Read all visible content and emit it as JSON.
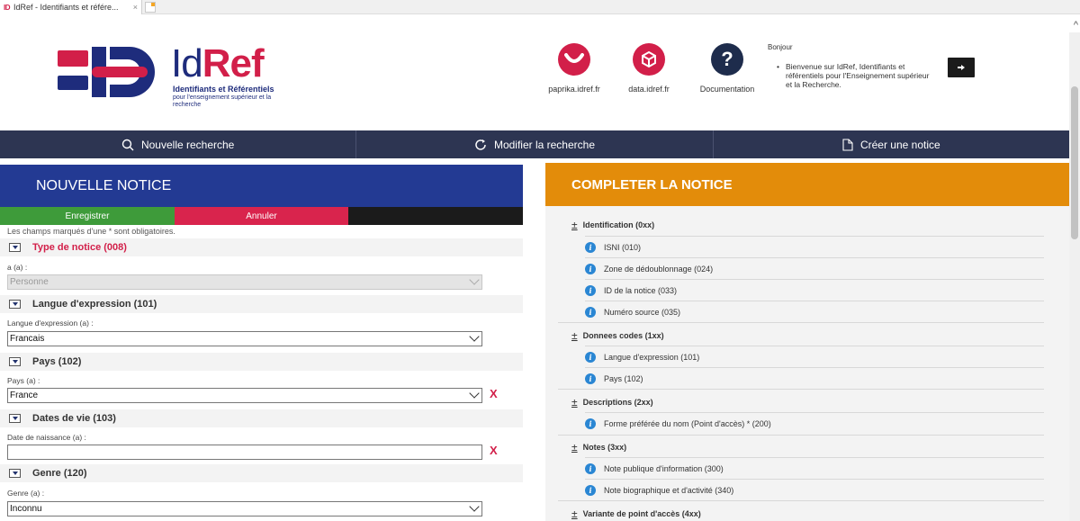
{
  "browser": {
    "tab_title": "IdRef - Identifiants et référe...",
    "tab_close": "×",
    "favicon": "ID"
  },
  "logo": {
    "word_id": "Id",
    "word_ref": "Ref",
    "sub1": "Identifiants et Référentiels",
    "sub2": "pour l'enseignement supérieur et la recherche"
  },
  "header_links": [
    {
      "label": "paprika.idref.fr",
      "icon": "smile-icon"
    },
    {
      "label": "data.idref.fr",
      "icon": "cube-icon"
    },
    {
      "label": "Documentation",
      "icon": "question-icon"
    }
  ],
  "greeting": {
    "title": "Bonjour",
    "text": "Bienvenue sur IdRef, Identifiants et référentiels pour l'Enseignement supérieur et la Recherche."
  },
  "logout_icon": "logout-icon",
  "nav": {
    "search": "Nouvelle recherche",
    "modify": "Modifier la recherche",
    "create": "Créer une notice"
  },
  "left": {
    "title": "NOUVELLE NOTICE",
    "save": "Enregistrer",
    "cancel": "Annuler",
    "mandatory": "Les champs marqués d'une * sont obligatoires.",
    "sections": [
      {
        "title": "Type de notice (008)",
        "label": "a (a) :",
        "value": "Personne"
      },
      {
        "title": "Langue d'expression (101)",
        "label": "Langue d'expression (a) :",
        "value": "Francais"
      },
      {
        "title": "Pays (102)",
        "label": "Pays (a) :",
        "value": "France"
      },
      {
        "title": "Dates de vie (103)",
        "label": "Date de naissance (a) :",
        "value": ""
      },
      {
        "title": "Genre (120)",
        "label": "Genre (a) :",
        "value": "Inconnu"
      }
    ],
    "remove": "X"
  },
  "right": {
    "title": "COMPLETER LA NOTICE",
    "plus": "±",
    "groups": [
      {
        "title": "Identification (0xx)",
        "items": [
          "ISNI (010)",
          "Zone de dédoublonnage (024)",
          "ID de la notice (033)",
          "Numéro source (035)"
        ]
      },
      {
        "title": "Donnees codes (1xx)",
        "items": [
          "Langue d'expression (101)",
          "Pays (102)"
        ]
      },
      {
        "title": "Descriptions (2xx)",
        "items": [
          "Forme préférée du nom (Point d'accès) * (200)"
        ]
      },
      {
        "title": "Notes (3xx)",
        "items": [
          "Note publique d'information (300)",
          "Note biographique et d'activité (340)"
        ]
      },
      {
        "title": "Variante de point d'accès (4xx)",
        "items": []
      }
    ],
    "info": "i"
  }
}
